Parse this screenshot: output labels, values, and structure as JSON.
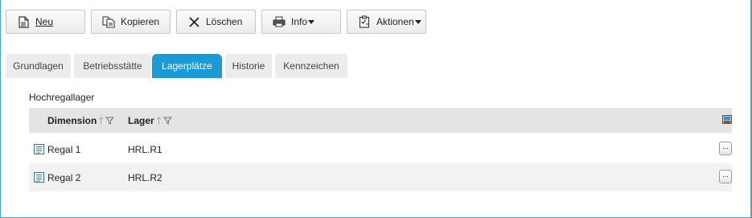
{
  "toolbar": {
    "new_label": "Neu",
    "copy_label": "Kopieren",
    "delete_label": "Löschen",
    "info_label": "Info",
    "actions_label": "Aktionen"
  },
  "tabs": [
    {
      "label": "Grundlagen",
      "active": false
    },
    {
      "label": "Betriebsstätte",
      "active": false
    },
    {
      "label": "Lagerplätze",
      "active": true
    },
    {
      "label": "Historie",
      "active": false
    },
    {
      "label": "Kennzeichen",
      "active": false
    }
  ],
  "section": {
    "title": "Hochregallager"
  },
  "grid": {
    "columns": {
      "dimension": "Dimension",
      "lager": "Lager"
    },
    "rows": [
      {
        "dimension": "Regal 1",
        "lager": "HRL.R1",
        "more": "..."
      },
      {
        "dimension": "Regal 2",
        "lager": "HRL.R2",
        "more": "..."
      }
    ]
  },
  "colors": {
    "accent": "#1a9ad6",
    "tab_inactive": "#ececec",
    "header_bg": "#e4e4e4",
    "row_alt": "#f2f2f2"
  },
  "icons": {
    "new": "document-icon",
    "copy": "copy-icon",
    "delete": "close-icon",
    "info": "printer-icon",
    "actions": "clipboard-icon",
    "sort": "sort-arrows-icon",
    "filter": "filter-icon",
    "column_chooser": "column-chooser-icon",
    "row": "list-document-icon"
  }
}
